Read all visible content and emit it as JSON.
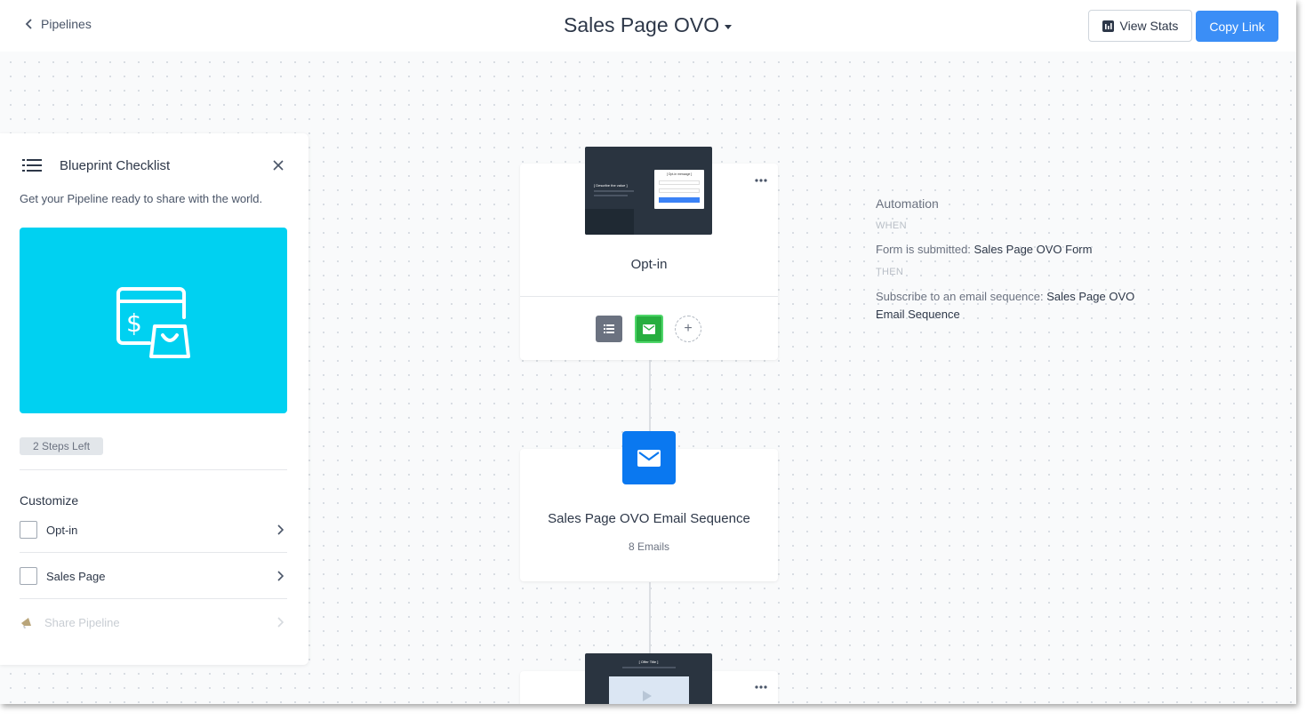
{
  "header": {
    "back_label": "Pipelines",
    "title": "Sales Page OVO",
    "view_stats_label": "View Stats",
    "copy_link_label": "Copy Link"
  },
  "checklist": {
    "title": "Blueprint Checklist",
    "subtitle": "Get your Pipeline ready to share with the world.",
    "steps_left": "2 Steps Left",
    "section_label": "Customize",
    "items": [
      {
        "label": "Opt-in",
        "checked": false,
        "enabled": true
      },
      {
        "label": "Sales Page",
        "checked": false,
        "enabled": true
      },
      {
        "label": "Share Pipeline",
        "checked": false,
        "enabled": false
      }
    ],
    "hero_color": "#00d1f1"
  },
  "pipeline": {
    "optin": {
      "title": "Opt-in",
      "thumb_heading": "[ Describe the value ]",
      "thumb_form_title": "[ Opt-in message ]"
    },
    "email_sequence": {
      "title": "Sales Page OVO Email Sequence",
      "subtitle": "8 Emails"
    },
    "next_page": {
      "thumb_heading": "[ Offer Title ]"
    }
  },
  "automation": {
    "title": "Automation",
    "when_label": "WHEN",
    "when_prefix": "Form is submitted: ",
    "when_value": "Sales Page OVO Form",
    "then_label": "THEN",
    "then_prefix": "Subscribe to an email sequence: ",
    "then_value": "Sales Page OVO Email Sequence"
  },
  "colors": {
    "accent": "#3b8ef6",
    "email_icon_bg": "#0a78f0",
    "email_action_bg": "#27ae3f",
    "form_action_bg": "#6b7280"
  }
}
